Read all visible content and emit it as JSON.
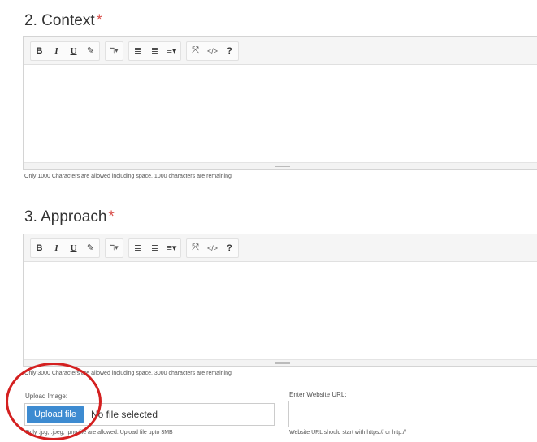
{
  "sections": {
    "context": {
      "title": "2. Context",
      "required_mark": "*",
      "hint": "Only 1000 Characters are allowed including space. 1000 characters are remaining"
    },
    "approach": {
      "title": "3. Approach",
      "required_mark": "*",
      "hint": "Only 3000 Characters are allowed including space. 3000 characters are remaining"
    }
  },
  "toolbar": {
    "bold": "B",
    "italic": "I",
    "underline": "U",
    "eraser": "✎",
    "font_style": "ℸ▾",
    "unordered_list": "≣",
    "ordered_list": "≣",
    "paragraph": "≡▾",
    "fullscreen": "⤧",
    "code_view": "</>",
    "help": "?"
  },
  "upload": {
    "label": "Upload Image:",
    "button_label": "Upload file",
    "status": "No file selected",
    "hint": "Only .jpg, .jpeg, .png file are allowed. Upload file upto 3MB"
  },
  "website": {
    "label": "Enter Website URL:",
    "value": "",
    "hint": "Website URL should start with https:// or http://"
  },
  "annotation": {
    "circle_color": "#d42020"
  }
}
